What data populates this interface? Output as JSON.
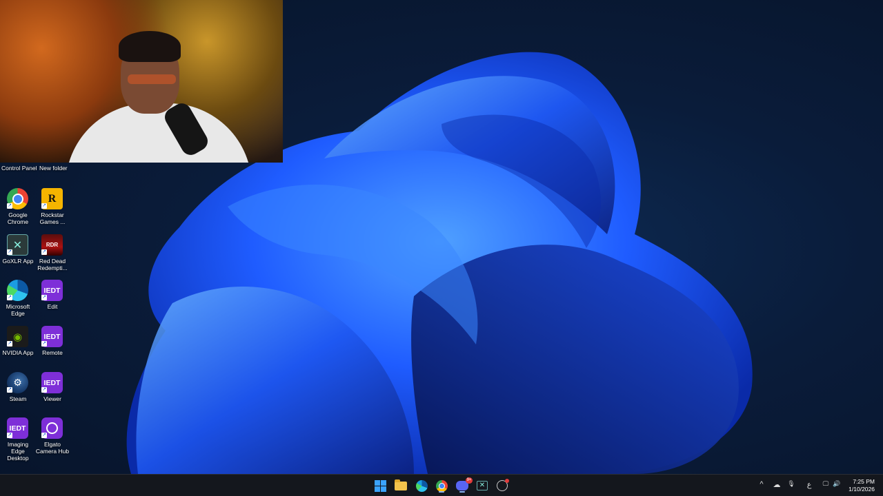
{
  "desktop": {
    "top_labels": [
      "Control Panel",
      "New folder"
    ],
    "icons": [
      {
        "label": "Google Chrome",
        "icon": "chrome-icon",
        "glyph": ""
      },
      {
        "label": "Rockstar Games ...",
        "icon": "rockstar-icon",
        "glyph": "R"
      },
      {
        "label": "GoXLR App",
        "icon": "goxlr-icon",
        "glyph": "✕"
      },
      {
        "label": "Red Dead Redempti...",
        "icon": "red-dead-icon",
        "glyph": "RDR"
      },
      {
        "label": "Microsoft Edge",
        "icon": "edge-icon",
        "glyph": ""
      },
      {
        "label": "Edit",
        "icon": "iedt-icon",
        "glyph": "IEDT"
      },
      {
        "label": "NVIDIA App",
        "icon": "nvidia-icon",
        "glyph": "◉"
      },
      {
        "label": "Remote",
        "icon": "iedt-icon",
        "glyph": "IEDT"
      },
      {
        "label": "Steam",
        "icon": "steam-icon",
        "glyph": "⚙"
      },
      {
        "label": "Viewer",
        "icon": "iedt-icon",
        "glyph": "IEDT"
      },
      {
        "label": "Imaging Edge Desktop",
        "icon": "iedt-icon",
        "glyph": "IEDT"
      },
      {
        "label": "Elgato Camera Hub",
        "icon": "elgato-icon",
        "glyph": ""
      }
    ],
    "shortcut_glyph": "↗"
  },
  "taskbar": {
    "icons": [
      "start-icon",
      "file-explorer-icon",
      "edge-icon",
      "chrome-icon",
      "discord-icon",
      "xbox-icon",
      "steam-icon"
    ],
    "discord_badge": "9+",
    "xbox_glyph": "✕",
    "tray": {
      "chevron": "^",
      "cloud": "☁",
      "mic": "🎙",
      "ime": "ع",
      "network": "🖵",
      "volume": "🔊"
    },
    "clock": {
      "time": "7:25 PM",
      "date": "1/10/2026"
    }
  },
  "colors": {
    "accent": "#3aa3ff",
    "wallpaper_bloom": "#1f5cff",
    "taskbar_bg": "#14171d"
  }
}
